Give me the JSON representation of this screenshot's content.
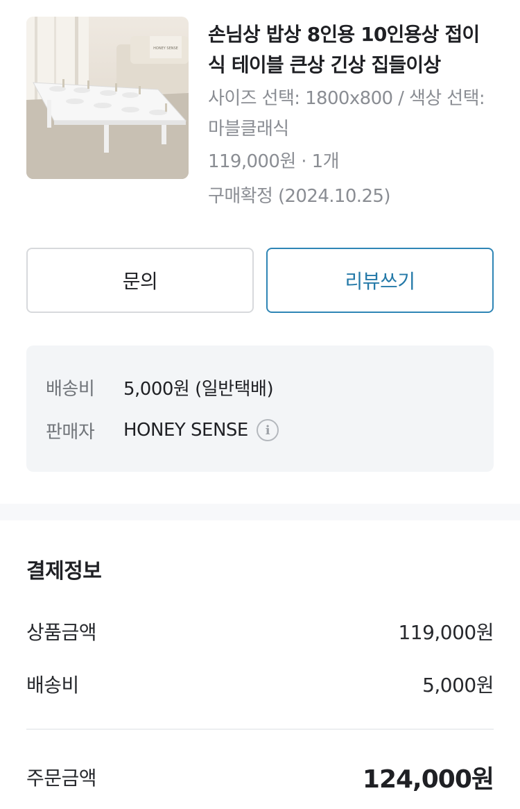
{
  "product": {
    "image_brand_text": "HONEY SENSE",
    "title": "손님상 밥상 8인용 10인용상 접이식 테이블 큰상 긴상 집들이상",
    "option": "사이즈 선택: 1800x800 / 색상 선택: 마블클래식",
    "price_qty": "119,000원 · 1개",
    "status": "구매확정 (2024.10.25)"
  },
  "buttons": {
    "inquiry": "문의",
    "review": "리뷰쓰기"
  },
  "shipping": {
    "fee_label": "배송비",
    "fee_value": "5,000원 (일반택배)",
    "seller_label": "판매자",
    "seller_value": "HONEY SENSE",
    "info_icon": "info-icon"
  },
  "payment": {
    "title": "결제정보",
    "rows": [
      {
        "label": "상품금액",
        "value": "119,000원"
      },
      {
        "label": "배송비",
        "value": "5,000원"
      }
    ],
    "total_label": "주문금액",
    "total_value": "124,000원"
  },
  "colors": {
    "accent": "#2e85b5",
    "muted_text": "#8a8d93",
    "box_bg": "#f3f5f7"
  }
}
